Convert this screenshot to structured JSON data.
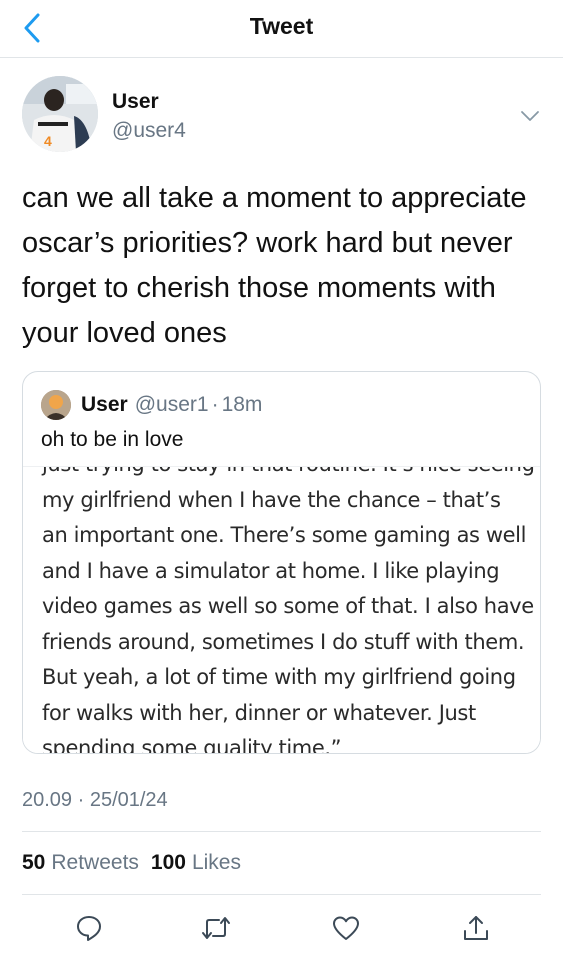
{
  "header": {
    "title": "Tweet",
    "back_icon": "chevron-left-icon"
  },
  "author": {
    "name": "User",
    "handle": "@user4",
    "avatar_jersey_number": "4"
  },
  "tweet": {
    "text": "can we all take a moment to appreciate oscar’s priorities? work hard but never forget to cherish those moments with your loved ones"
  },
  "quoted_tweet": {
    "name": "User",
    "handle": "@user1",
    "separator": "·",
    "time": "18m",
    "text": "oh to be in love",
    "image_text_lines": [
      "just trying to stay in that routine. It’s nice seeing",
      "my girlfriend when I have the chance – that’s",
      "an important one. There’s some gaming as well",
      "and I have a simulator at home. I like playing",
      "video games as well so some of that. I also have",
      "friends around, sometimes I do stuff with them.",
      "But yeah, a lot of time with my girlfriend going",
      "for walks with her, dinner or whatever. Just",
      "spending some quality time.”"
    ]
  },
  "meta": {
    "timestamp": "20.09 · 25/01/24"
  },
  "stats": {
    "retweets_count": "50",
    "retweets_label": "Retweets",
    "likes_count": "100",
    "likes_label": "Likes"
  },
  "actions": [
    "reply-icon",
    "retweet-icon",
    "like-icon",
    "share-icon"
  ],
  "colors": {
    "accent": "#1d9bf0",
    "muted": "#687684",
    "border": "#e1e5e8",
    "text": "#111111"
  }
}
